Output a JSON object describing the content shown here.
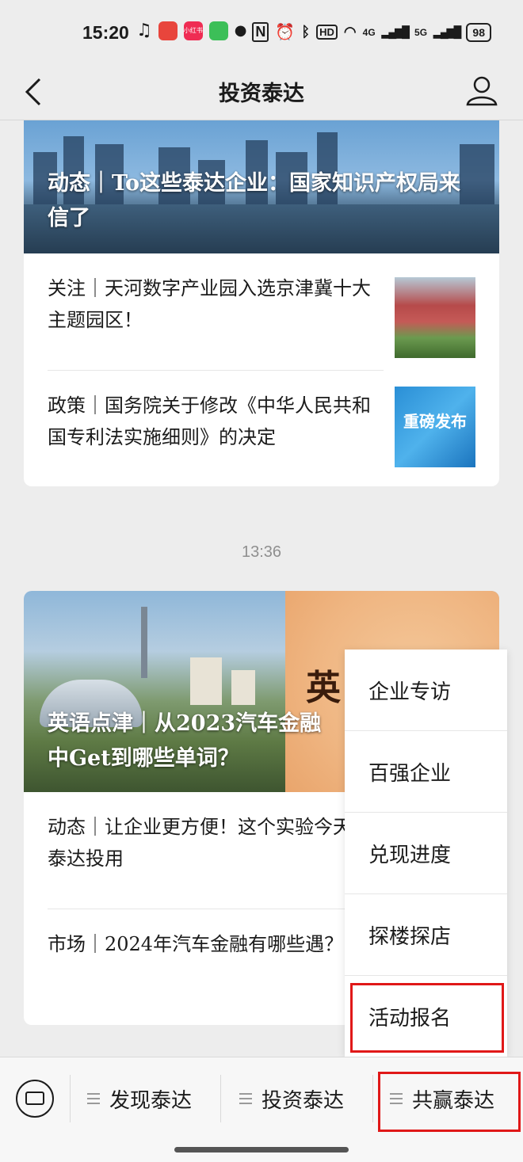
{
  "status": {
    "time": "15:20",
    "left_icons": [
      "listen-icon",
      "app-badge-red",
      "app-badge-pink",
      "wechat-green-icon",
      "dot-icon"
    ],
    "right_icons": [
      "nfc-icon",
      "alarm-icon",
      "bluetooth-icon",
      "hd-icon",
      "wifi-icon",
      "4g-signal-icon",
      "5g-signal-icon"
    ],
    "badge_small_label": "小红书",
    "hd_label": "HD",
    "net1": "4G",
    "net2": "5G",
    "battery": "98"
  },
  "nav": {
    "title": "投资泰达"
  },
  "feed": {
    "group1": {
      "hero_title": "动态｜To这些泰达企业：国家知识产权局来信了",
      "articles": [
        {
          "title": "关注｜天河数字产业园入选京津冀十大主题园区！"
        },
        {
          "title": "政策｜国务院关于修改《中华人民共和国专利法实施细则》的决定",
          "thumb_text": "重磅发布"
        }
      ]
    },
    "timestamp": "13:36",
    "group2": {
      "hero_title": "英语点津｜从2023汽车金融中Get到哪些单词？",
      "hero_char": "英",
      "articles": [
        {
          "title": "动态｜让企业更方便！这个实验今天在泰达投用"
        },
        {
          "title": "市场｜2024年汽车金融有哪些遇？"
        }
      ]
    }
  },
  "popup_menu": {
    "items": [
      "企业专访",
      "百强企业",
      "兑现进度",
      "探楼探店",
      "活动报名"
    ]
  },
  "bottom_menu": {
    "items": [
      "发现泰达",
      "投资泰达",
      "共赢泰达"
    ]
  },
  "colors": {
    "highlight": "#e01818",
    "background": "#ededed",
    "card": "#ffffff",
    "timestamp": "#8f8f8f"
  }
}
